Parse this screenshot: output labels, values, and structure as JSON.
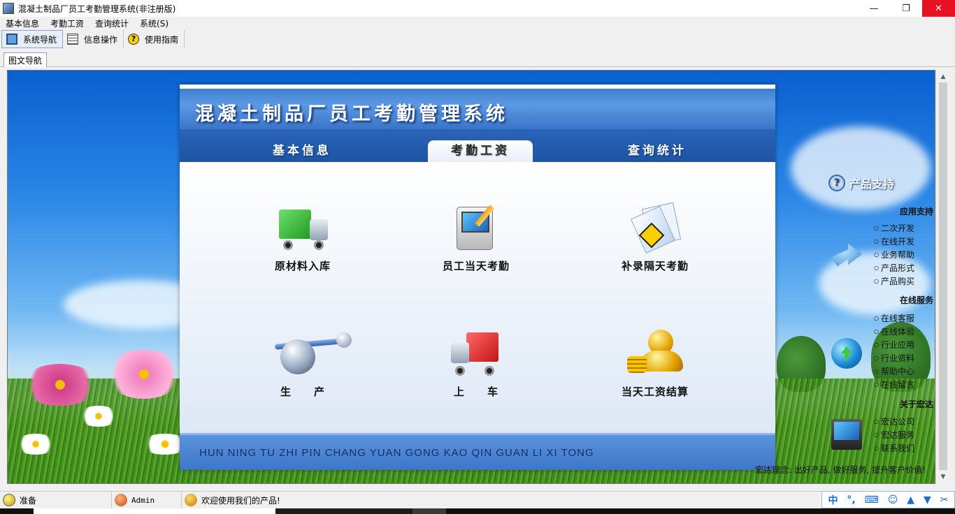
{
  "window": {
    "title": "混凝土制品厂员工考勤管理系统(非注册版)",
    "controls": {
      "minimize": "—",
      "maximize": "❐",
      "close": "✕"
    }
  },
  "menu": [
    "基本信息",
    "考勤工资",
    "查询统计",
    "系统(S)"
  ],
  "toolbar": [
    {
      "label": "系统导航",
      "icon": "monitor-icon",
      "active": true
    },
    {
      "label": "信息操作",
      "icon": "grid-icon",
      "active": false
    },
    {
      "label": "使用指南",
      "icon": "help-icon",
      "active": false
    }
  ],
  "tab": "图文导航",
  "panel": {
    "title": "混凝土制品厂员工考勤管理系统",
    "tabs": [
      "基本信息",
      "考勤工资",
      "查询统计"
    ],
    "active_tab": "考勤工资",
    "functions": [
      {
        "label": "原材料入库",
        "icon": "green-truck-icon"
      },
      {
        "label": "员工当天考勤",
        "icon": "computer-icon"
      },
      {
        "label": "补录隔天考勤",
        "icon": "document-sign-icon"
      },
      {
        "label": "生　　产",
        "icon": "production-icon"
      },
      {
        "label": "上　　车",
        "icon": "red-truck-icon"
      },
      {
        "label": "当天工资结算",
        "icon": "gold-person-icon"
      }
    ],
    "pinyin": "HUN NING TU ZHI PIN CHANG YUAN GONG KAO QIN GUAN LI XI TONG"
  },
  "support": {
    "title": "产品支持",
    "sections": [
      {
        "title": "应用支持",
        "icon": "arrow-icon",
        "links": [
          "二次开发",
          "在线开发",
          "业务帮助",
          "产品形式",
          "产品购买"
        ]
      },
      {
        "title": "在线服务",
        "icon": "globe-icon",
        "links": [
          "在线客服",
          "在线体验",
          "行业应用",
          "行业资料",
          "帮助中心",
          "在线留言"
        ]
      },
      {
        "title": "关于宏达",
        "icon": "monitor-icon",
        "links": [
          "宏达公司",
          "宏达服务",
          "联系我们"
        ]
      }
    ],
    "motto": "宏达理念: 出好产品, 做好服务, 提升客户价值!"
  },
  "status": {
    "ready": "准备",
    "user": "Admin",
    "welcome": "欢迎使用我们的产品!"
  },
  "ime": [
    "中",
    "°,",
    "⌨",
    "☺",
    "▲",
    "▼",
    "✂"
  ],
  "colors": {
    "accent": "#3b74c9",
    "close": "#e81123"
  }
}
